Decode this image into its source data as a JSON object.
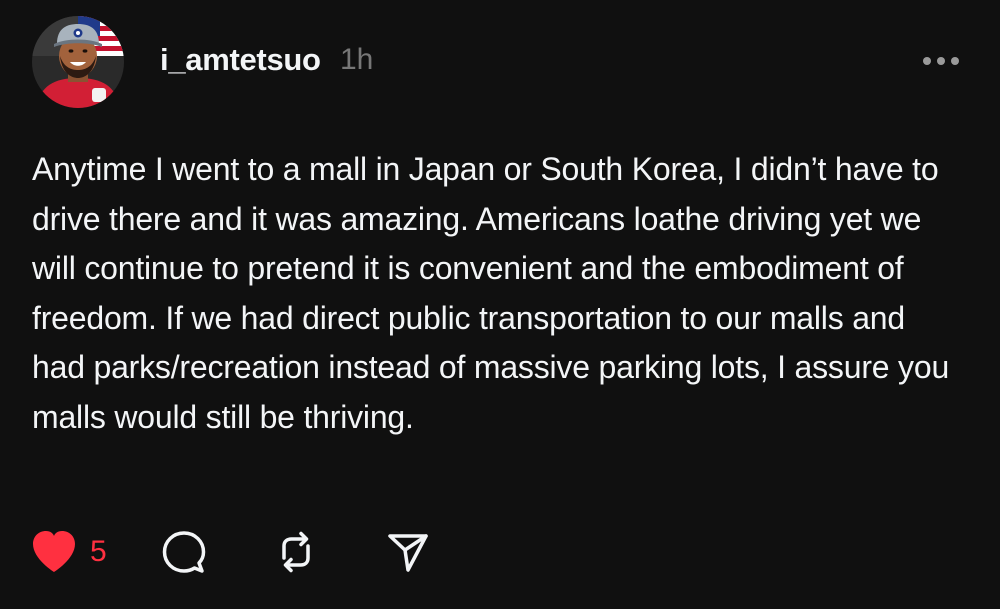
{
  "post": {
    "author": {
      "username": "i_amtetsuo",
      "time_ago": "1h"
    },
    "text": "Anytime I went to a mall in Japan or South Korea, I didn’t have to drive there and it was amazing. Americans loathe driving yet we will continue to pretend it is convenient and the embodiment of freedom. If we had direct public transportation to our malls and had parks/recreation instead of massive parking lots, I assure you malls would still be thriving.",
    "actions": {
      "like": {
        "icon": "heart-filled-icon",
        "count": "5",
        "color": "#ff3040"
      },
      "comment": {
        "icon": "comment-icon"
      },
      "repost": {
        "icon": "repost-icon"
      },
      "share": {
        "icon": "share-send-icon"
      }
    },
    "more_menu_icon": "more-horizontal-icon"
  },
  "theme": {
    "background": "#101010",
    "text": "#f3f5f7",
    "muted": "#777777",
    "like_red": "#ff3040"
  }
}
